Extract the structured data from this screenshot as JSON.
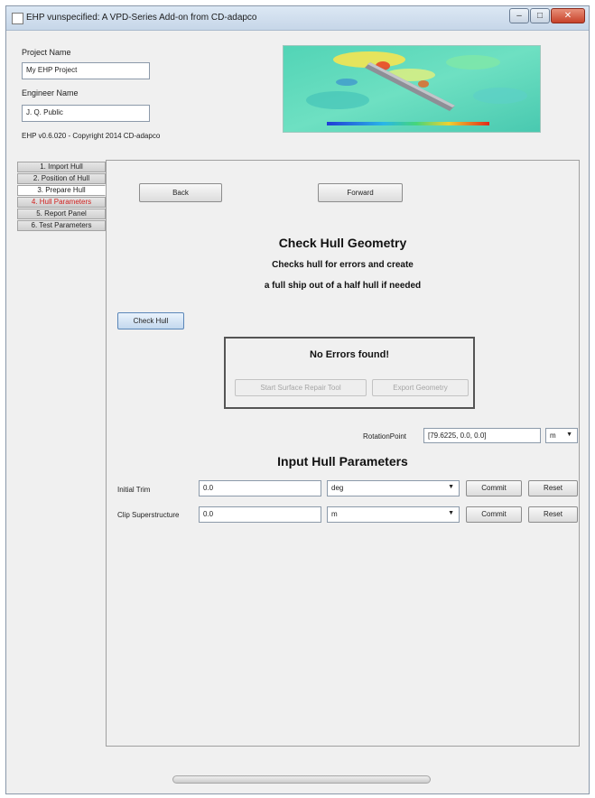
{
  "window": {
    "title": "EHP vunspecified: A VPD-Series Add-on from CD-adapco",
    "controls": [
      "–",
      "□",
      "✕"
    ]
  },
  "header": {
    "project_name_label": "Project Name",
    "project_name_value": "My EHP Project",
    "engineer_name_label": "Engineer Name",
    "engineer_name_value": "J. Q. Public",
    "copyright": "EHP v0.6.020 - Copyright 2014 CD-adapco"
  },
  "tabs": [
    {
      "label": "1. Import Hull"
    },
    {
      "label": "2. Position of Hull"
    },
    {
      "label": "3. Prepare Hull"
    },
    {
      "label": "4. Hull Parameters"
    },
    {
      "label": "5. Report Panel"
    },
    {
      "label": "6. Test Parameters"
    }
  ],
  "nav": {
    "back_label": "Back",
    "forward_label": "Forward"
  },
  "check": {
    "title": "Check Hull Geometry",
    "subtitle_line1": "Checks hull for errors and create",
    "subtitle_line2": "a full ship out of a half hull if needed",
    "button_label": "Check Hull",
    "result_text": "No Errors found!",
    "repair_label": "Start Surface Repair Tool",
    "export_label": "Export Geometry"
  },
  "rotation": {
    "label": "RotationPoint",
    "value": "[79.6225, 0.0, 0.0]",
    "unit": "m"
  },
  "params": {
    "title": "Input Hull Parameters",
    "rows": [
      {
        "label": "Initial Trim",
        "value": "0.0",
        "unit": "deg",
        "commit": "Commit",
        "reset": "Reset"
      },
      {
        "label": "Clip Superstructure",
        "value": "0.0",
        "unit": "m",
        "commit": "Commit",
        "reset": "Reset"
      }
    ]
  },
  "colors": {
    "active_tab_text": "#d0201e",
    "accent_button": "#c3d8ee"
  }
}
